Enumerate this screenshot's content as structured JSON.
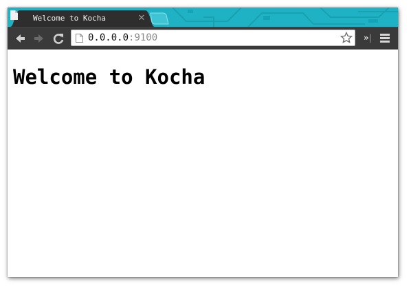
{
  "browser": {
    "tab": {
      "title": "Welcome to Kocha"
    },
    "url": {
      "host": "0.0.0.0",
      "port": ":9100"
    }
  },
  "page": {
    "heading": "Welcome to Kocha"
  },
  "icons": [
    "document-icon",
    "close-icon",
    "back-arrow-icon",
    "forward-arrow-icon",
    "reload-icon",
    "star-icon",
    "chevron-double-right-icon",
    "menu-icon"
  ],
  "colors": {
    "titlebar": "#1fb2c4",
    "toolbar": "#3a3a3a",
    "tab": "#2e2e2e"
  }
}
